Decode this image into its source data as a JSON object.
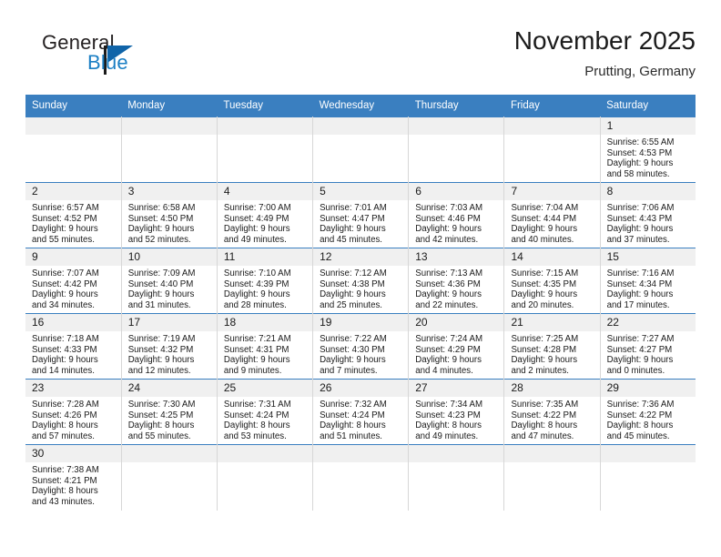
{
  "brand": {
    "name_part1": "General",
    "name_part2": "Blue",
    "logo_icon": "triangle-flag-icon"
  },
  "header": {
    "month_title": "November 2025",
    "location": "Prutting, Germany"
  },
  "colors": {
    "header_blue": "#3a7fc0",
    "brand_blue": "#1b7fc4",
    "daynum_bg": "#f0f0f0",
    "cell_border": "#d7d7d7"
  },
  "weekdays": [
    "Sunday",
    "Monday",
    "Tuesday",
    "Wednesday",
    "Thursday",
    "Friday",
    "Saturday"
  ],
  "weeks": [
    [
      {
        "day": "",
        "sunrise": "",
        "sunset": "",
        "daylight1": "",
        "daylight2": "",
        "empty": true
      },
      {
        "day": "",
        "sunrise": "",
        "sunset": "",
        "daylight1": "",
        "daylight2": "",
        "empty": true
      },
      {
        "day": "",
        "sunrise": "",
        "sunset": "",
        "daylight1": "",
        "daylight2": "",
        "empty": true
      },
      {
        "day": "",
        "sunrise": "",
        "sunset": "",
        "daylight1": "",
        "daylight2": "",
        "empty": true
      },
      {
        "day": "",
        "sunrise": "",
        "sunset": "",
        "daylight1": "",
        "daylight2": "",
        "empty": true
      },
      {
        "day": "",
        "sunrise": "",
        "sunset": "",
        "daylight1": "",
        "daylight2": "",
        "empty": true
      },
      {
        "day": "1",
        "sunrise": "Sunrise: 6:55 AM",
        "sunset": "Sunset: 4:53 PM",
        "daylight1": "Daylight: 9 hours",
        "daylight2": "and 58 minutes."
      }
    ],
    [
      {
        "day": "2",
        "sunrise": "Sunrise: 6:57 AM",
        "sunset": "Sunset: 4:52 PM",
        "daylight1": "Daylight: 9 hours",
        "daylight2": "and 55 minutes."
      },
      {
        "day": "3",
        "sunrise": "Sunrise: 6:58 AM",
        "sunset": "Sunset: 4:50 PM",
        "daylight1": "Daylight: 9 hours",
        "daylight2": "and 52 minutes."
      },
      {
        "day": "4",
        "sunrise": "Sunrise: 7:00 AM",
        "sunset": "Sunset: 4:49 PM",
        "daylight1": "Daylight: 9 hours",
        "daylight2": "and 49 minutes."
      },
      {
        "day": "5",
        "sunrise": "Sunrise: 7:01 AM",
        "sunset": "Sunset: 4:47 PM",
        "daylight1": "Daylight: 9 hours",
        "daylight2": "and 45 minutes."
      },
      {
        "day": "6",
        "sunrise": "Sunrise: 7:03 AM",
        "sunset": "Sunset: 4:46 PM",
        "daylight1": "Daylight: 9 hours",
        "daylight2": "and 42 minutes."
      },
      {
        "day": "7",
        "sunrise": "Sunrise: 7:04 AM",
        "sunset": "Sunset: 4:44 PM",
        "daylight1": "Daylight: 9 hours",
        "daylight2": "and 40 minutes."
      },
      {
        "day": "8",
        "sunrise": "Sunrise: 7:06 AM",
        "sunset": "Sunset: 4:43 PM",
        "daylight1": "Daylight: 9 hours",
        "daylight2": "and 37 minutes."
      }
    ],
    [
      {
        "day": "9",
        "sunrise": "Sunrise: 7:07 AM",
        "sunset": "Sunset: 4:42 PM",
        "daylight1": "Daylight: 9 hours",
        "daylight2": "and 34 minutes."
      },
      {
        "day": "10",
        "sunrise": "Sunrise: 7:09 AM",
        "sunset": "Sunset: 4:40 PM",
        "daylight1": "Daylight: 9 hours",
        "daylight2": "and 31 minutes."
      },
      {
        "day": "11",
        "sunrise": "Sunrise: 7:10 AM",
        "sunset": "Sunset: 4:39 PM",
        "daylight1": "Daylight: 9 hours",
        "daylight2": "and 28 minutes."
      },
      {
        "day": "12",
        "sunrise": "Sunrise: 7:12 AM",
        "sunset": "Sunset: 4:38 PM",
        "daylight1": "Daylight: 9 hours",
        "daylight2": "and 25 minutes."
      },
      {
        "day": "13",
        "sunrise": "Sunrise: 7:13 AM",
        "sunset": "Sunset: 4:36 PM",
        "daylight1": "Daylight: 9 hours",
        "daylight2": "and 22 minutes."
      },
      {
        "day": "14",
        "sunrise": "Sunrise: 7:15 AM",
        "sunset": "Sunset: 4:35 PM",
        "daylight1": "Daylight: 9 hours",
        "daylight2": "and 20 minutes."
      },
      {
        "day": "15",
        "sunrise": "Sunrise: 7:16 AM",
        "sunset": "Sunset: 4:34 PM",
        "daylight1": "Daylight: 9 hours",
        "daylight2": "and 17 minutes."
      }
    ],
    [
      {
        "day": "16",
        "sunrise": "Sunrise: 7:18 AM",
        "sunset": "Sunset: 4:33 PM",
        "daylight1": "Daylight: 9 hours",
        "daylight2": "and 14 minutes."
      },
      {
        "day": "17",
        "sunrise": "Sunrise: 7:19 AM",
        "sunset": "Sunset: 4:32 PM",
        "daylight1": "Daylight: 9 hours",
        "daylight2": "and 12 minutes."
      },
      {
        "day": "18",
        "sunrise": "Sunrise: 7:21 AM",
        "sunset": "Sunset: 4:31 PM",
        "daylight1": "Daylight: 9 hours",
        "daylight2": "and 9 minutes."
      },
      {
        "day": "19",
        "sunrise": "Sunrise: 7:22 AM",
        "sunset": "Sunset: 4:30 PM",
        "daylight1": "Daylight: 9 hours",
        "daylight2": "and 7 minutes."
      },
      {
        "day": "20",
        "sunrise": "Sunrise: 7:24 AM",
        "sunset": "Sunset: 4:29 PM",
        "daylight1": "Daylight: 9 hours",
        "daylight2": "and 4 minutes."
      },
      {
        "day": "21",
        "sunrise": "Sunrise: 7:25 AM",
        "sunset": "Sunset: 4:28 PM",
        "daylight1": "Daylight: 9 hours",
        "daylight2": "and 2 minutes."
      },
      {
        "day": "22",
        "sunrise": "Sunrise: 7:27 AM",
        "sunset": "Sunset: 4:27 PM",
        "daylight1": "Daylight: 9 hours",
        "daylight2": "and 0 minutes."
      }
    ],
    [
      {
        "day": "23",
        "sunrise": "Sunrise: 7:28 AM",
        "sunset": "Sunset: 4:26 PM",
        "daylight1": "Daylight: 8 hours",
        "daylight2": "and 57 minutes."
      },
      {
        "day": "24",
        "sunrise": "Sunrise: 7:30 AM",
        "sunset": "Sunset: 4:25 PM",
        "daylight1": "Daylight: 8 hours",
        "daylight2": "and 55 minutes."
      },
      {
        "day": "25",
        "sunrise": "Sunrise: 7:31 AM",
        "sunset": "Sunset: 4:24 PM",
        "daylight1": "Daylight: 8 hours",
        "daylight2": "and 53 minutes."
      },
      {
        "day": "26",
        "sunrise": "Sunrise: 7:32 AM",
        "sunset": "Sunset: 4:24 PM",
        "daylight1": "Daylight: 8 hours",
        "daylight2": "and 51 minutes."
      },
      {
        "day": "27",
        "sunrise": "Sunrise: 7:34 AM",
        "sunset": "Sunset: 4:23 PM",
        "daylight1": "Daylight: 8 hours",
        "daylight2": "and 49 minutes."
      },
      {
        "day": "28",
        "sunrise": "Sunrise: 7:35 AM",
        "sunset": "Sunset: 4:22 PM",
        "daylight1": "Daylight: 8 hours",
        "daylight2": "and 47 minutes."
      },
      {
        "day": "29",
        "sunrise": "Sunrise: 7:36 AM",
        "sunset": "Sunset: 4:22 PM",
        "daylight1": "Daylight: 8 hours",
        "daylight2": "and 45 minutes."
      }
    ],
    [
      {
        "day": "30",
        "sunrise": "Sunrise: 7:38 AM",
        "sunset": "Sunset: 4:21 PM",
        "daylight1": "Daylight: 8 hours",
        "daylight2": "and 43 minutes."
      },
      {
        "day": "",
        "sunrise": "",
        "sunset": "",
        "daylight1": "",
        "daylight2": "",
        "empty": true
      },
      {
        "day": "",
        "sunrise": "",
        "sunset": "",
        "daylight1": "",
        "daylight2": "",
        "empty": true
      },
      {
        "day": "",
        "sunrise": "",
        "sunset": "",
        "daylight1": "",
        "daylight2": "",
        "empty": true
      },
      {
        "day": "",
        "sunrise": "",
        "sunset": "",
        "daylight1": "",
        "daylight2": "",
        "empty": true
      },
      {
        "day": "",
        "sunrise": "",
        "sunset": "",
        "daylight1": "",
        "daylight2": "",
        "empty": true
      },
      {
        "day": "",
        "sunrise": "",
        "sunset": "",
        "daylight1": "",
        "daylight2": "",
        "empty": true
      }
    ]
  ]
}
